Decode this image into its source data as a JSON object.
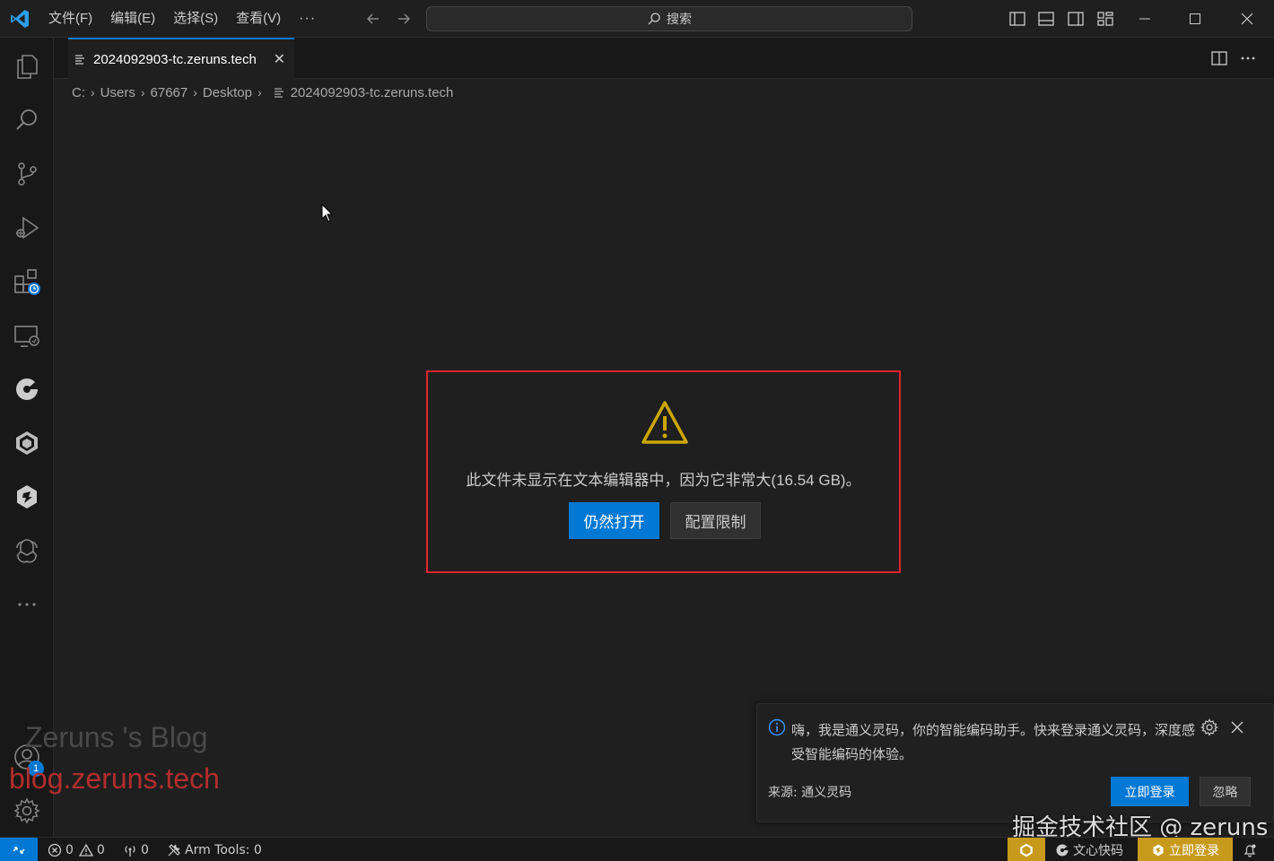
{
  "menu": {
    "items": [
      "文件(F)",
      "编辑(E)",
      "选择(S)",
      "查看(V)"
    ],
    "more": "···"
  },
  "search": {
    "label": "搜索"
  },
  "tab": {
    "label": "2024092903-tc.zeruns.tech",
    "close": "✕"
  },
  "breadcrumb": {
    "parts": [
      "C:",
      "Users",
      "67667",
      "Desktop"
    ],
    "file": "2024092903-tc.zeruns.tech"
  },
  "warning": {
    "message": "此文件未显示在文本编辑器中，因为它非常大(16.54 GB)。",
    "open_anyway": "仍然打开",
    "configure_limit": "配置限制"
  },
  "notification": {
    "text": "嗨，我是通义灵码，你的智能编码助手。快来登录通义灵码，深度感受智能编码的体验。",
    "source": "来源: 通义灵码",
    "login_button": "立即登录",
    "ignore_button": "忽略"
  },
  "accounts_badge": "1",
  "watermarks": {
    "blog_name": "Zeruns 's Blog",
    "blog_url": "blog.zeruns.tech",
    "juejin": "掘金技术社区 @ zeruns"
  },
  "status": {
    "errors": "0",
    "warnings": "0",
    "ports": "0",
    "arm_tools": "Arm Tools: 0",
    "wenxin": "文心快码",
    "login": "立即登录"
  },
  "colors": {
    "accent": "#0078d4",
    "warning_icon": "#cca700",
    "highlight_frame": "#e0252e",
    "status_gold": "#c89a1c"
  }
}
